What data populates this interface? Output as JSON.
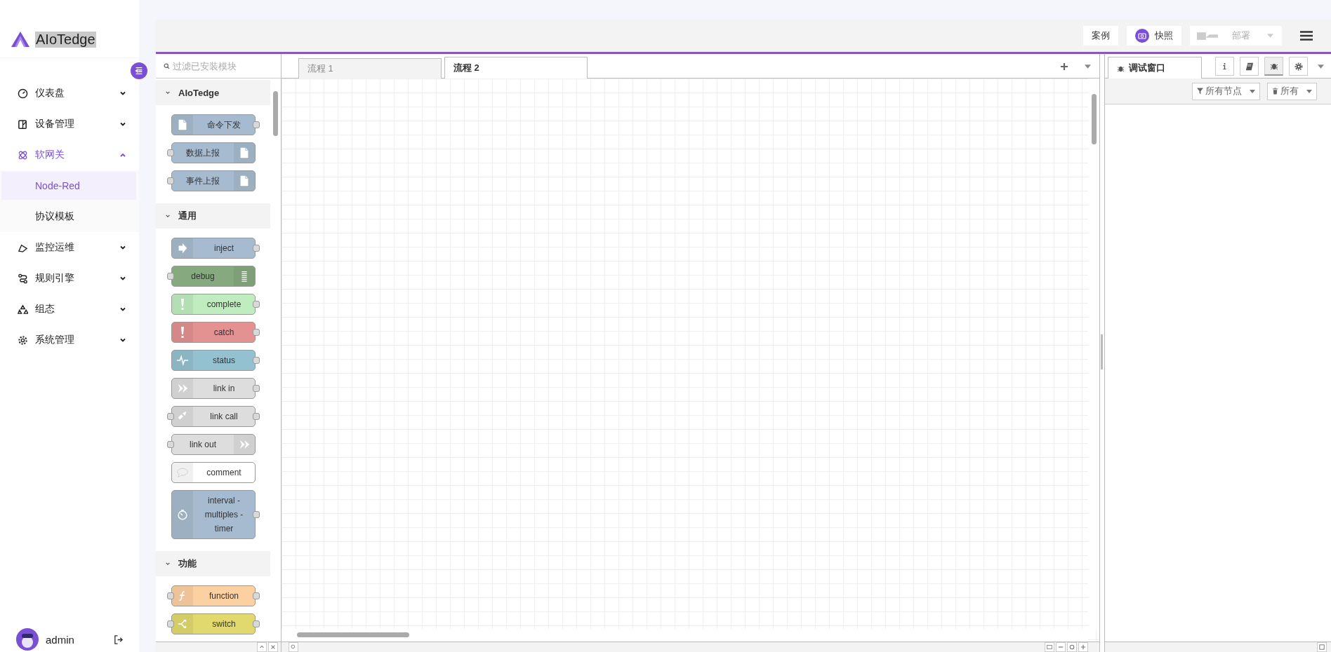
{
  "brand": {
    "name": "AIoTedge"
  },
  "menu": [
    {
      "kind": "gauge",
      "label": "仪表盘",
      "expanded": false,
      "selected": false
    },
    {
      "kind": "device",
      "label": "设备管理",
      "expanded": false,
      "selected": false
    },
    {
      "kind": "atom",
      "label": "软网关",
      "expanded": true,
      "selected": true,
      "children": [
        {
          "label": "Node-Red",
          "selected": true
        },
        {
          "label": "协议模板",
          "selected": false
        }
      ]
    },
    {
      "kind": "monitor",
      "label": "监控运维",
      "expanded": false,
      "selected": false
    },
    {
      "kind": "flow",
      "label": "规则引擎",
      "expanded": false,
      "selected": false
    },
    {
      "kind": "recycle",
      "label": "组态",
      "expanded": false,
      "selected": false
    },
    {
      "kind": "gear",
      "label": "系统管理",
      "expanded": false,
      "selected": false
    }
  ],
  "user": {
    "name": "admin"
  },
  "toolbar": {
    "buttons": [
      {
        "kind": "text",
        "label": "案例",
        "disabled": false
      },
      {
        "kind": "camera",
        "label": "快照",
        "disabled": false
      },
      {
        "kind": "deploy",
        "label": "部署",
        "disabled": true
      }
    ]
  },
  "palette": {
    "search": {
      "placeholder": "过滤已安装模块"
    },
    "categories": [
      {
        "name": "AIoTedge",
        "expanded": true,
        "nodes": [
          {
            "label": "命令下发",
            "color": "#a6bbcf",
            "kind": "file",
            "icon_right": false,
            "input": false,
            "output": true
          },
          {
            "label": "数据上报",
            "color": "#a6bbcf",
            "kind": "file",
            "icon_right": true,
            "input": true,
            "output": false
          },
          {
            "label": "事件上报",
            "color": "#a6bbcf",
            "kind": "file",
            "icon_right": true,
            "input": true,
            "output": false
          }
        ]
      },
      {
        "name": "通用",
        "expanded": true,
        "nodes": [
          {
            "label": "inject",
            "color": "#a6bbcf",
            "kind": "inject",
            "icon_right": false,
            "input": false,
            "output": true
          },
          {
            "label": "debug",
            "color": "#87a980",
            "kind": "list",
            "icon_right": true,
            "input": true,
            "output": false
          },
          {
            "label": "complete",
            "color": "#c0edc0",
            "kind": "alert",
            "icon_right": false,
            "input": false,
            "output": true
          },
          {
            "label": "catch",
            "color": "#e49191",
            "kind": "alert",
            "icon_right": false,
            "input": false,
            "output": true
          },
          {
            "label": "status",
            "color": "#94c1d0",
            "kind": "pulse",
            "icon_right": false,
            "input": false,
            "output": true
          },
          {
            "label": "link in",
            "color": "#dddddd",
            "kind": "link",
            "icon_right": false,
            "input": false,
            "output": true
          },
          {
            "label": "link call",
            "color": "#dddddd",
            "kind": "linkcall",
            "icon_right": false,
            "input": true,
            "output": true
          },
          {
            "label": "link out",
            "color": "#dddddd",
            "kind": "link",
            "icon_right": true,
            "input": true,
            "output": false
          },
          {
            "label": "comment",
            "color": "#ffffff",
            "kind": "comment",
            "icon_right": false,
            "input": false,
            "output": false
          },
          {
            "label": "interval - multiples - timer",
            "color": "#a6bbcf",
            "kind": "timer",
            "icon_right": false,
            "input": false,
            "output": true
          }
        ]
      },
      {
        "name": "功能",
        "expanded": true,
        "nodes": [
          {
            "label": "function",
            "color": "#fdd0a2",
            "kind": "function",
            "icon_right": false,
            "input": true,
            "output": true
          },
          {
            "label": "switch",
            "color": "#e2d96e",
            "kind": "switch",
            "icon_right": false,
            "input": true,
            "output": true
          }
        ]
      }
    ]
  },
  "workspace": {
    "tabs": [
      {
        "label": "流程 1",
        "selected": false
      },
      {
        "label": "流程 2",
        "selected": true
      }
    ]
  },
  "side_panel": {
    "tabs": [
      {
        "label": "调试窗口",
        "selected": true
      }
    ],
    "tools": [
      {
        "kind": "info",
        "selected": false
      },
      {
        "kind": "book",
        "selected": false
      },
      {
        "kind": "bug",
        "selected": true
      },
      {
        "kind": "gear",
        "selected": false
      }
    ],
    "filters": [
      {
        "kind": "filter",
        "label": "所有节点"
      },
      {
        "kind": "trash",
        "label": "所有"
      }
    ]
  }
}
